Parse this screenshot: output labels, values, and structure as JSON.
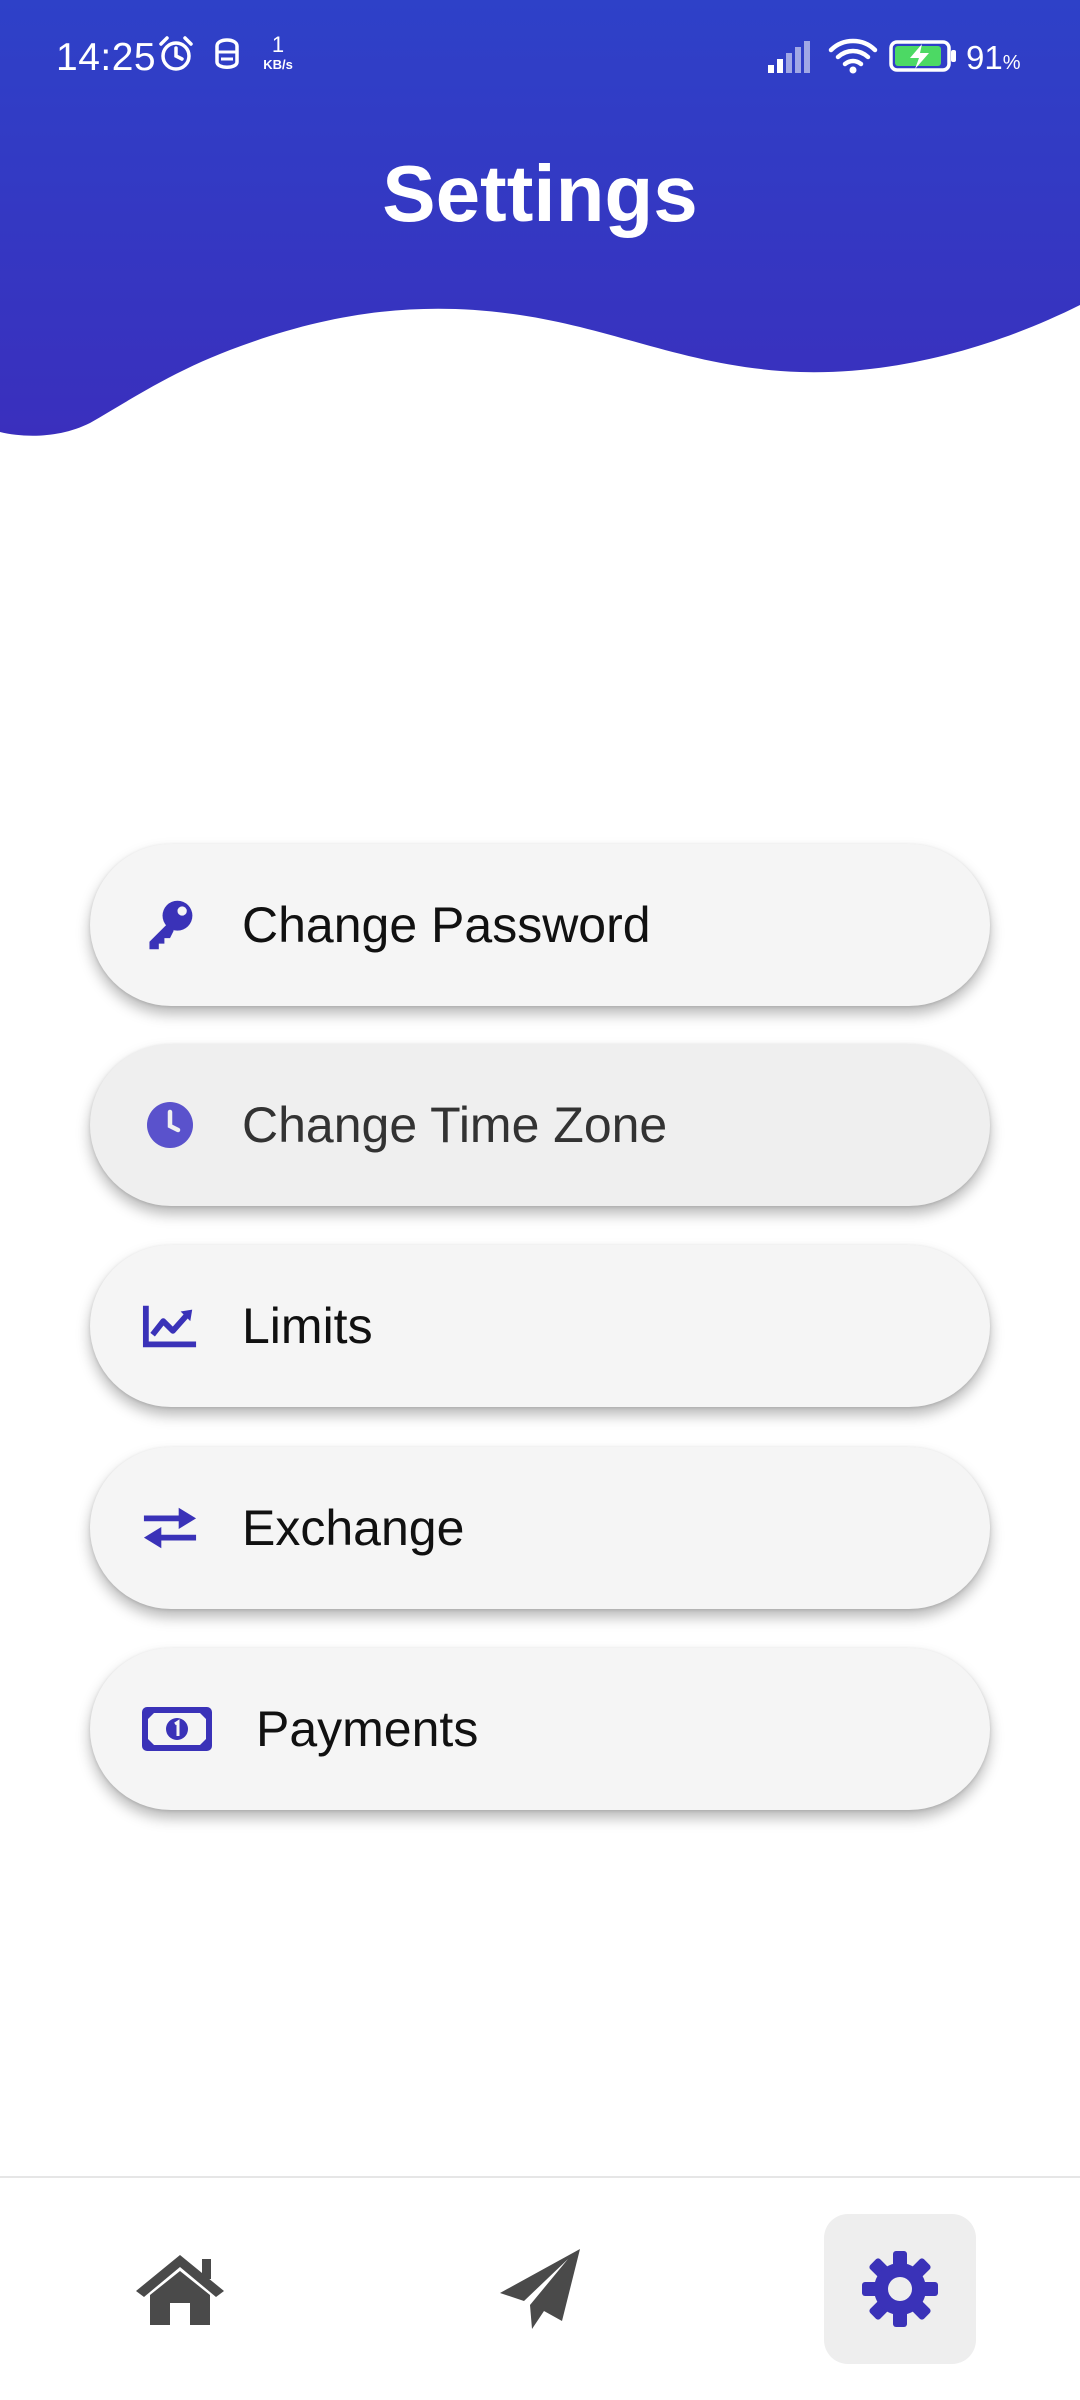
{
  "status_bar": {
    "time": "14:25",
    "net_speed_value": "1",
    "net_speed_unit": "KB/s",
    "battery_percent": "91",
    "battery_unit": "%"
  },
  "header": {
    "title": "Settings",
    "background_color": "#3535c4"
  },
  "menu": {
    "items": [
      {
        "label": "Change Password",
        "icon": "key-icon"
      },
      {
        "label": "Change Time Zone",
        "icon": "clock-icon"
      },
      {
        "label": "Limits",
        "icon": "chart-line-icon"
      },
      {
        "label": "Exchange",
        "icon": "exchange-arrows-icon"
      },
      {
        "label": "Payments",
        "icon": "money-bill-icon"
      }
    ],
    "accent_color": "#3a32b8"
  },
  "bottom_nav": {
    "items": [
      {
        "icon": "home-icon"
      },
      {
        "icon": "paper-plane-icon"
      },
      {
        "icon": "gear-icon",
        "selected": true
      }
    ],
    "selected_color": "#3a32b8",
    "inactive_color": "#4a4a4a"
  }
}
